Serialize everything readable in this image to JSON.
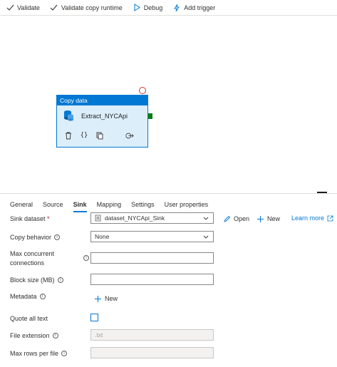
{
  "toolbar": {
    "validate": "Validate",
    "validate_runtime": "Validate copy runtime",
    "debug": "Debug",
    "add_trigger": "Add trigger"
  },
  "activity": {
    "type": "Copy data",
    "name": "Extract_NYCApi"
  },
  "tabs": [
    {
      "label": "General"
    },
    {
      "label": "Source"
    },
    {
      "label": "Sink"
    },
    {
      "label": "Mapping"
    },
    {
      "label": "Settings"
    },
    {
      "label": "User properties"
    }
  ],
  "active_tab": "Sink",
  "form": {
    "sink_dataset": {
      "label": "Sink dataset",
      "required_mark": "*",
      "value": "dataset_NYCApi_Sink",
      "open": "Open",
      "new": "New",
      "learn_more": "Learn more"
    },
    "copy_behavior": {
      "label": "Copy behavior",
      "value": "None"
    },
    "max_concurrent": {
      "label_line1": "Max concurrent",
      "label_line2": "connections",
      "value": ""
    },
    "block_size": {
      "label": "Block size (MB)",
      "value": ""
    },
    "metadata": {
      "label": "Metadata",
      "new": "New"
    },
    "quote_all_text": {
      "label": "Quote all text",
      "checked": false
    },
    "file_extension": {
      "label": "File extension",
      "placeholder": ".txt"
    },
    "max_rows": {
      "label": "Max rows per file",
      "value": ""
    }
  },
  "colors": {
    "accent": "#0078d4",
    "success": "#107c10",
    "error": "#d13438"
  }
}
